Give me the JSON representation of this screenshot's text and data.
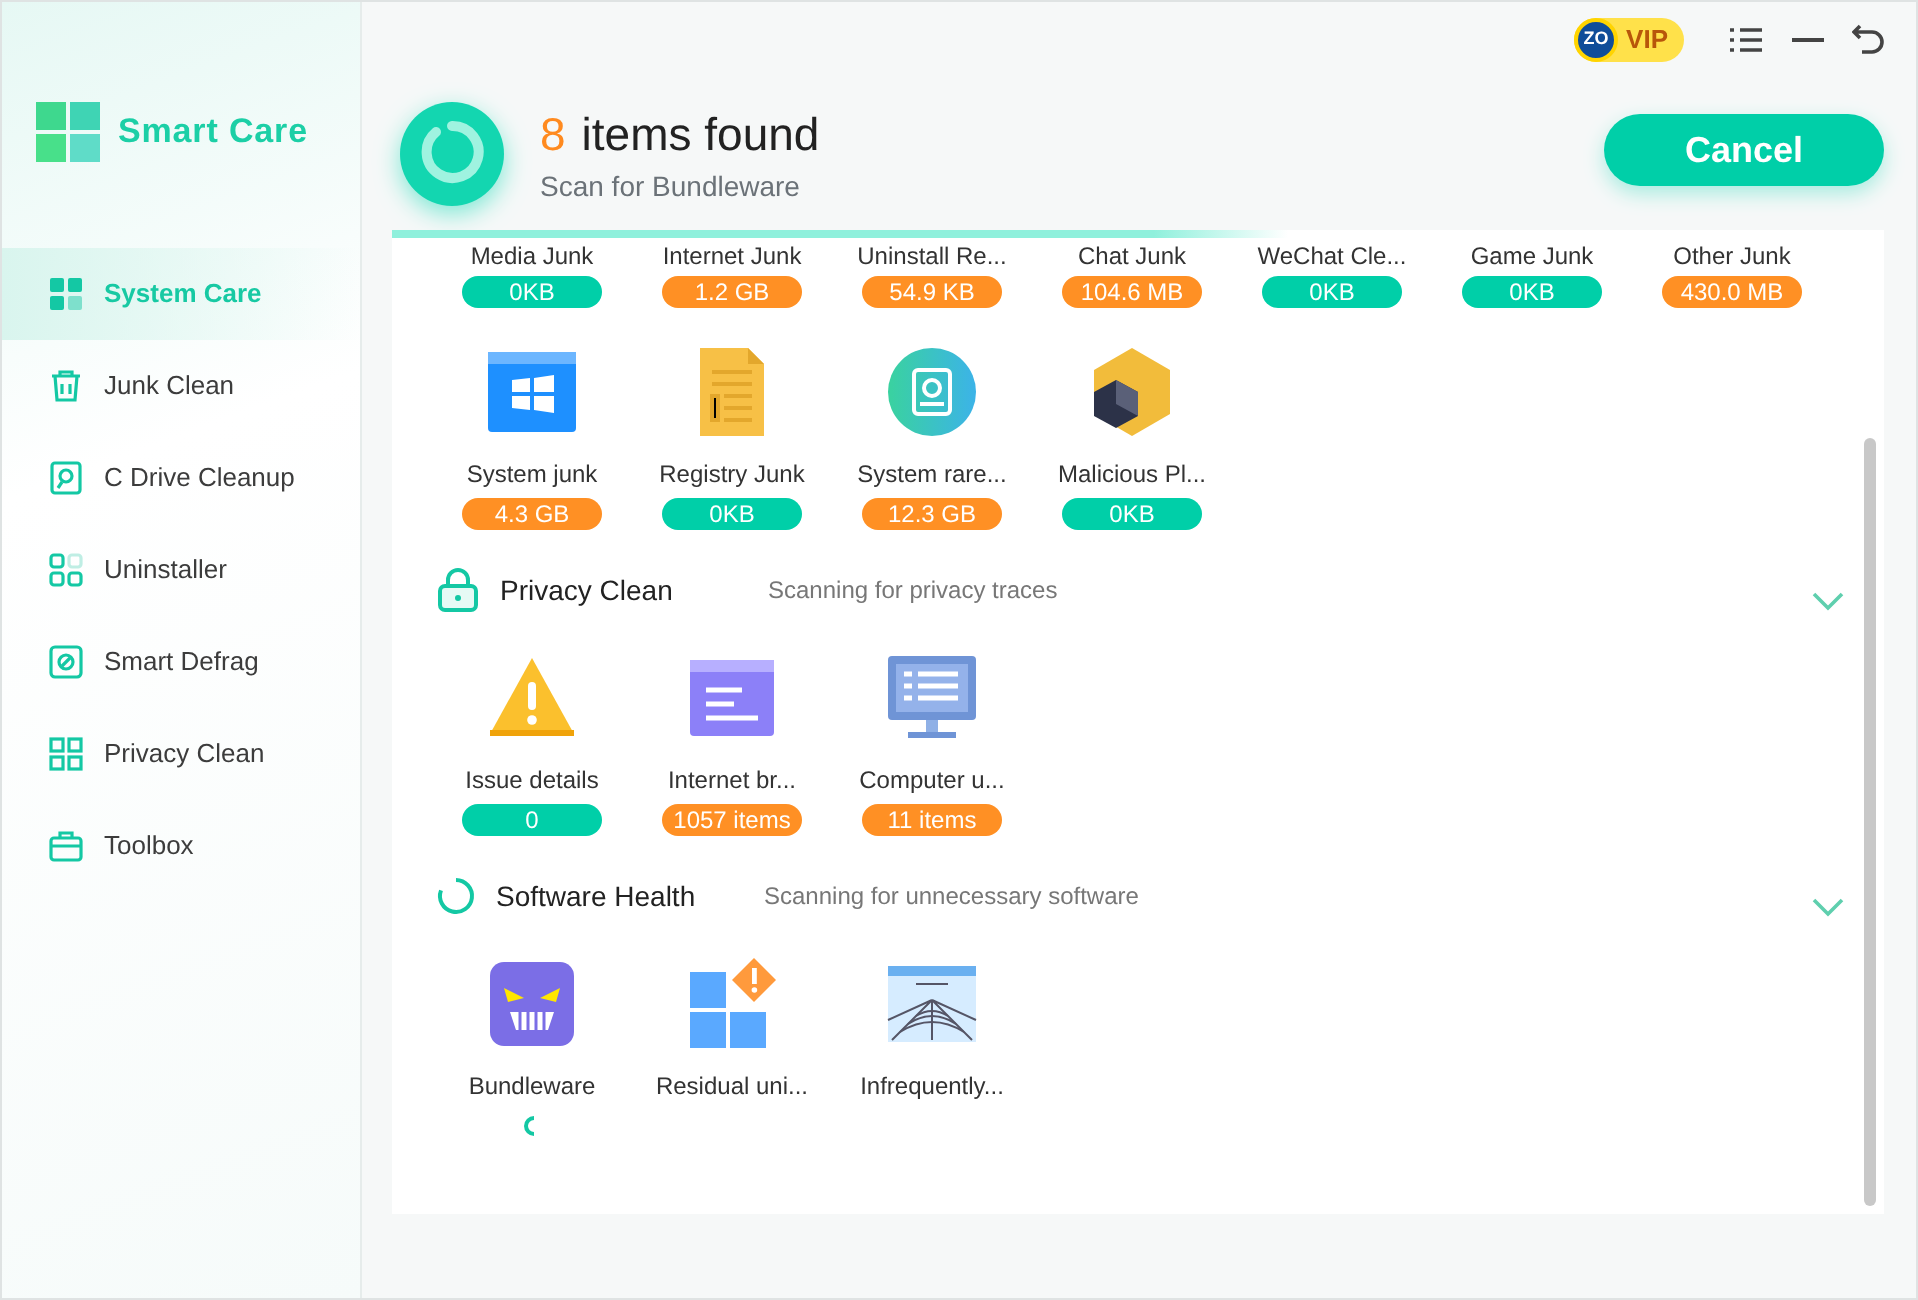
{
  "app": {
    "name": "Smart Care"
  },
  "sidebar": {
    "items": [
      {
        "label": "System Care",
        "selected": true
      },
      {
        "label": "Junk Clean",
        "selected": false
      },
      {
        "label": "C Drive Cleanup",
        "selected": false
      },
      {
        "label": "Uninstaller",
        "selected": false
      },
      {
        "label": "Smart Defrag",
        "selected": false
      },
      {
        "label": "Privacy Clean",
        "selected": false
      },
      {
        "label": "Toolbox",
        "selected": false
      }
    ]
  },
  "vip": {
    "avatar": "ZO",
    "label": "VIP"
  },
  "scan": {
    "count": "8",
    "title": "items found",
    "subtitle": "Scan for Bundleware",
    "level": 0.6
  },
  "cancel_button": "Cancel",
  "sections": [
    {
      "tiles": [
        {
          "label": "Media Junk",
          "value": "0KB",
          "color": "#00cfa8"
        },
        {
          "label": "Internet Junk",
          "value": "1.2 GB",
          "color": "#ff9024"
        },
        {
          "label": "Uninstall Re...",
          "value": "54.9 KB",
          "color": "#ff9024"
        },
        {
          "label": "Chat Junk",
          "value": "104.6 MB",
          "color": "#ff9024"
        },
        {
          "label": "WeChat Cle...",
          "value": "0KB",
          "color": "#00cfa8"
        },
        {
          "label": "Game Junk",
          "value": "0KB",
          "color": "#00cfa8"
        },
        {
          "label": "Other Junk",
          "value": "430.0 MB",
          "color": "#ff9024"
        },
        {
          "label": "System junk",
          "value": "4.3 GB",
          "color": "#ff9024"
        },
        {
          "label": "Registry Junk",
          "value": "0KB",
          "color": "#00cfa8"
        },
        {
          "label": "System rare...",
          "value": "12.3 GB",
          "color": "#ff9024"
        },
        {
          "label": "Malicious Pl...",
          "value": "0KB",
          "color": "#00cfa8"
        }
      ]
    },
    {
      "title": "Privacy Clean",
      "status": "Scanning for privacy traces",
      "tiles": [
        {
          "label": "Issue details",
          "value": "0",
          "color": "#00cfa8"
        },
        {
          "label": "Internet  br...",
          "value": "1057 items",
          "color": "#ff9024"
        },
        {
          "label": "Computer u...",
          "value": "11 items",
          "color": "#ff9024"
        }
      ]
    },
    {
      "title": "Software Health",
      "status": "Scanning for unnecessary software",
      "tiles": [
        {
          "label": "Bundleware",
          "scanning": true
        },
        {
          "label": "Residual uni...",
          "scanning": false
        },
        {
          "label": "Infrequently...",
          "scanning": false
        }
      ]
    }
  ]
}
